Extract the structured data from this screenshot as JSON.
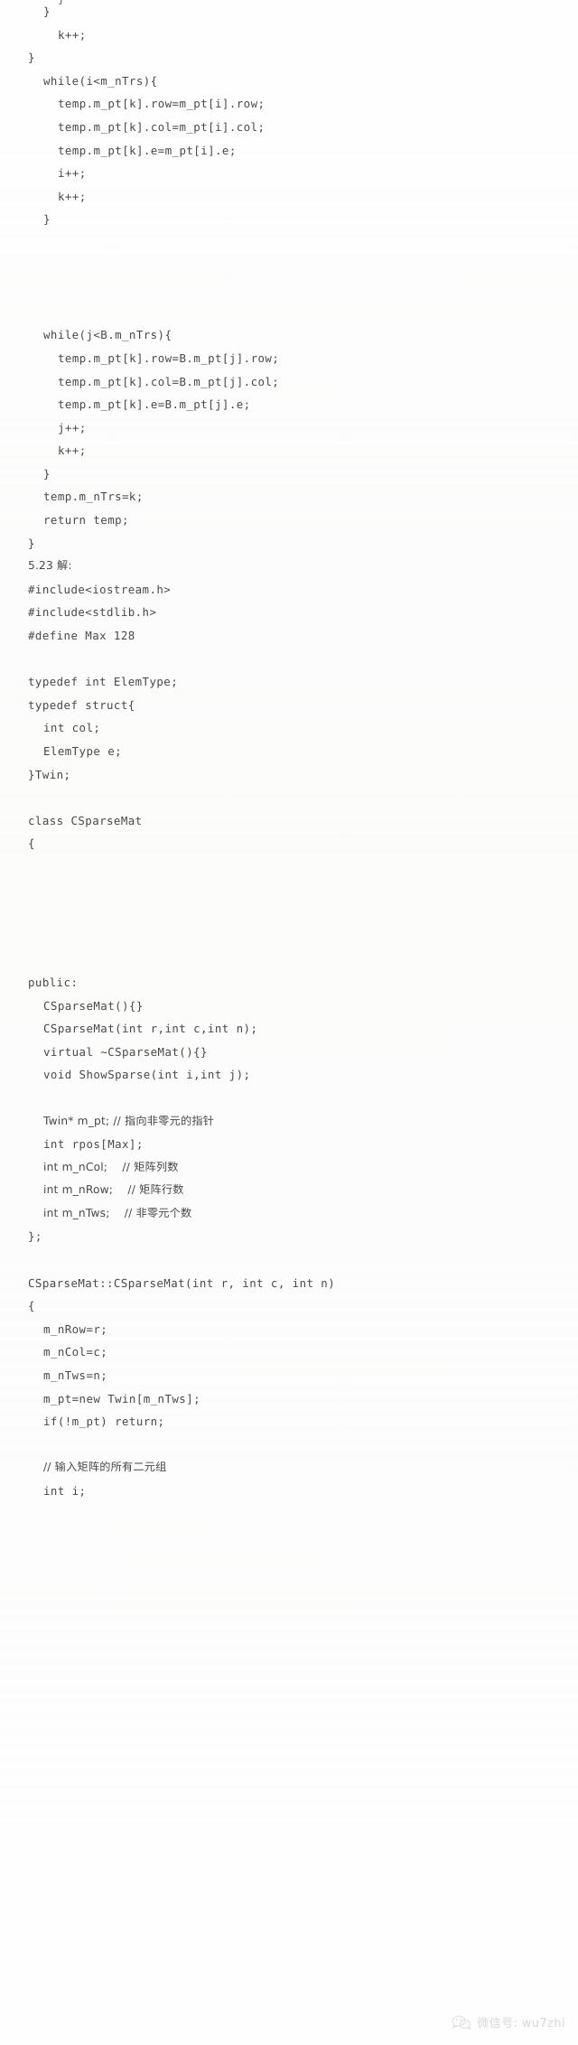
{
  "document": {
    "kind": "scanned-textbook-page",
    "language": "C++",
    "section_label": "5.23 解:",
    "text_color": "#3a3a3a",
    "background_color": "#fefefe"
  },
  "clipped_top_line": {
    "indent": 2,
    "text": "}"
  },
  "code_lines": [
    {
      "indent": 1,
      "text": "}"
    },
    {
      "indent": 2,
      "text": "k++;"
    },
    {
      "indent": 0,
      "text": "}"
    },
    {
      "indent": 1,
      "text": "while(i<m_nTrs){"
    },
    {
      "indent": 2,
      "text": "temp.m_pt[k].row=m_pt[i].row;"
    },
    {
      "indent": 2,
      "text": "temp.m_pt[k].col=m_pt[i].col;"
    },
    {
      "indent": 2,
      "text": "temp.m_pt[k].e=m_pt[i].e;"
    },
    {
      "indent": 2,
      "text": "i++;"
    },
    {
      "indent": 2,
      "text": "k++;"
    },
    {
      "indent": 1,
      "text": "}"
    },
    {
      "indent": 0,
      "text": ""
    },
    {
      "indent": 0,
      "text": ""
    },
    {
      "indent": 0,
      "text": ""
    },
    {
      "indent": 0,
      "text": ""
    },
    {
      "indent": 1,
      "text": "while(j<B.m_nTrs){"
    },
    {
      "indent": 2,
      "text": "temp.m_pt[k].row=B.m_pt[j].row;"
    },
    {
      "indent": 2,
      "text": "temp.m_pt[k].col=B.m_pt[j].col;"
    },
    {
      "indent": 2,
      "text": "temp.m_pt[k].e=B.m_pt[j].e;"
    },
    {
      "indent": 2,
      "text": "j++;"
    },
    {
      "indent": 2,
      "text": "k++;"
    },
    {
      "indent": 1,
      "text": "}"
    },
    {
      "indent": 1,
      "text": "temp.m_nTrs=k;"
    },
    {
      "indent": 1,
      "text": "return temp;"
    },
    {
      "indent": 0,
      "text": "}"
    },
    {
      "indent": 0,
      "text": "5.23 解:",
      "cjk": true
    },
    {
      "indent": 0,
      "text": "#include<iostream.h>"
    },
    {
      "indent": 0,
      "text": "#include<stdlib.h>"
    },
    {
      "indent": 0,
      "text": "#define Max 128"
    },
    {
      "indent": 0,
      "text": ""
    },
    {
      "indent": 0,
      "text": "typedef int ElemType;"
    },
    {
      "indent": 0,
      "text": "typedef struct{"
    },
    {
      "indent": 1,
      "text": "int col;"
    },
    {
      "indent": 1,
      "text": "ElemType e;"
    },
    {
      "indent": 0,
      "text": "}Twin;"
    },
    {
      "indent": 0,
      "text": ""
    },
    {
      "indent": 0,
      "text": "class CSparseMat"
    },
    {
      "indent": 0,
      "text": "{"
    },
    {
      "indent": 0,
      "text": ""
    },
    {
      "indent": 0,
      "text": ""
    },
    {
      "indent": 0,
      "text": ""
    },
    {
      "indent": 0,
      "text": ""
    },
    {
      "indent": 0,
      "text": ""
    },
    {
      "indent": 0,
      "text": "public:"
    },
    {
      "indent": 1,
      "text": "CSparseMat(){}"
    },
    {
      "indent": 1,
      "text": "CSparseMat(int r,int c,int n);"
    },
    {
      "indent": 1,
      "text": "virtual ~CSparseMat(){}"
    },
    {
      "indent": 1,
      "text": "void ShowSparse(int i,int j);"
    },
    {
      "indent": 0,
      "text": ""
    },
    {
      "indent": 1,
      "text": "Twin* m_pt; // 指向非零元的指针",
      "cjk": true
    },
    {
      "indent": 1,
      "text": "int rpos[Max];"
    },
    {
      "indent": 1,
      "text": "int m_nCol;    // 矩阵列数",
      "cjk": true
    },
    {
      "indent": 1,
      "text": "int m_nRow;    // 矩阵行数",
      "cjk": true
    },
    {
      "indent": 1,
      "text": "int m_nTws;    // 非零元个数",
      "cjk": true
    },
    {
      "indent": 0,
      "text": "};"
    },
    {
      "indent": 0,
      "text": ""
    },
    {
      "indent": 0,
      "text": "CSparseMat::CSparseMat(int r, int c, int n)"
    },
    {
      "indent": 0,
      "text": "{"
    },
    {
      "indent": 1,
      "text": "m_nRow=r;"
    },
    {
      "indent": 1,
      "text": "m_nCol=c;"
    },
    {
      "indent": 1,
      "text": "m_nTws=n;"
    },
    {
      "indent": 1,
      "text": "m_pt=new Twin[m_nTws];"
    },
    {
      "indent": 1,
      "text": "if(!m_pt) return;"
    },
    {
      "indent": 0,
      "text": ""
    },
    {
      "indent": 1,
      "text": "// 输入矩阵的所有二元组",
      "cjk": true
    },
    {
      "indent": 1,
      "text": "int i;"
    }
  ],
  "watermark": {
    "icon": "wechat-icon",
    "text": "微信号: wu7zhi",
    "color": "#d8d8d8"
  }
}
